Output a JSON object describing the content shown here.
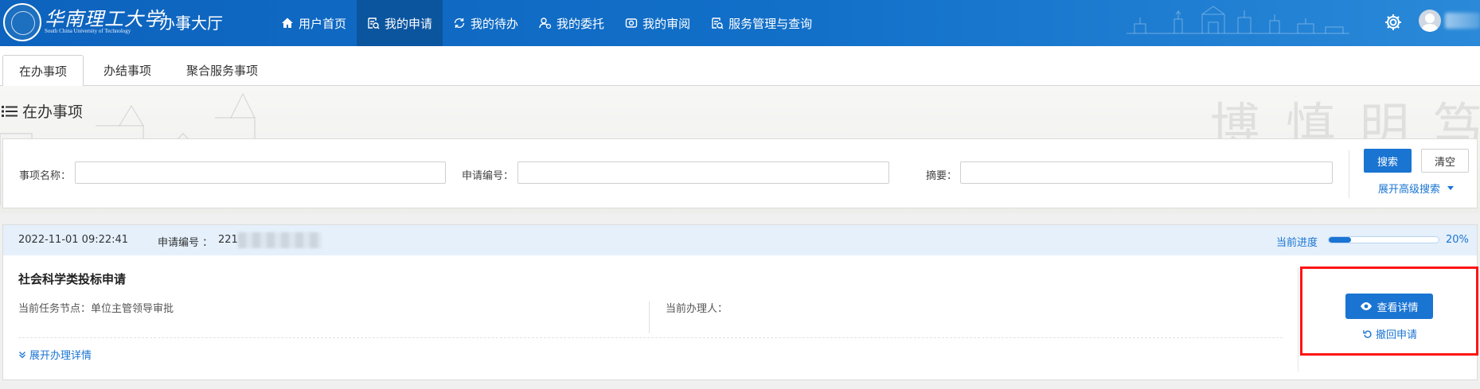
{
  "header": {
    "logo_text": "华南理工大学",
    "logo_en": "South China University of Technology",
    "separator": "·",
    "hall_title": "办事大厅",
    "nav": [
      {
        "label": "用户首页",
        "icon": "home-icon"
      },
      {
        "label": "我的申请",
        "icon": "application-icon",
        "active": true
      },
      {
        "label": "我的待办",
        "icon": "todo-icon"
      },
      {
        "label": "我的委托",
        "icon": "delegate-icon"
      },
      {
        "label": "我的审阅",
        "icon": "review-icon"
      },
      {
        "label": "服务管理与查询",
        "icon": "service-query-icon"
      }
    ],
    "settings_icon": "gear-icon",
    "avatar_icon": "user-avatar-icon"
  },
  "tabs": [
    {
      "label": "在办事项",
      "active": true
    },
    {
      "label": "办结事项"
    },
    {
      "label": "聚合服务事项"
    }
  ],
  "section": {
    "title": "在办事项",
    "icon": "list-icon"
  },
  "search": {
    "item_name_label": "事项名称：",
    "item_name_value": "",
    "app_no_label": "申请编号：",
    "app_no_value": "",
    "summary_label": "摘要：",
    "summary_value": "",
    "search_button": "搜索",
    "clear_button": "清空",
    "advanced_link": "展开高级搜索"
  },
  "items": [
    {
      "datetime": "2022-11-01 09:22:41",
      "app_no_label": "申请编号 ：",
      "app_no_visible": "221",
      "progress_label": "当前进度",
      "progress_percent": 20,
      "progress_text": "20%",
      "title": "社会科学类投标申请",
      "node_label": "当前任务节点：单位主管领导审批",
      "handler_label": "当前办理人：",
      "expand_label": "展开办理详情",
      "detail_button": "查看详情",
      "withdraw_label": "撤回申请"
    }
  ],
  "colors": {
    "header_bg": "#1270c9",
    "accent": "#1a74d2",
    "card_head_bg": "#e5f0fb",
    "highlight": "#ff1414"
  }
}
